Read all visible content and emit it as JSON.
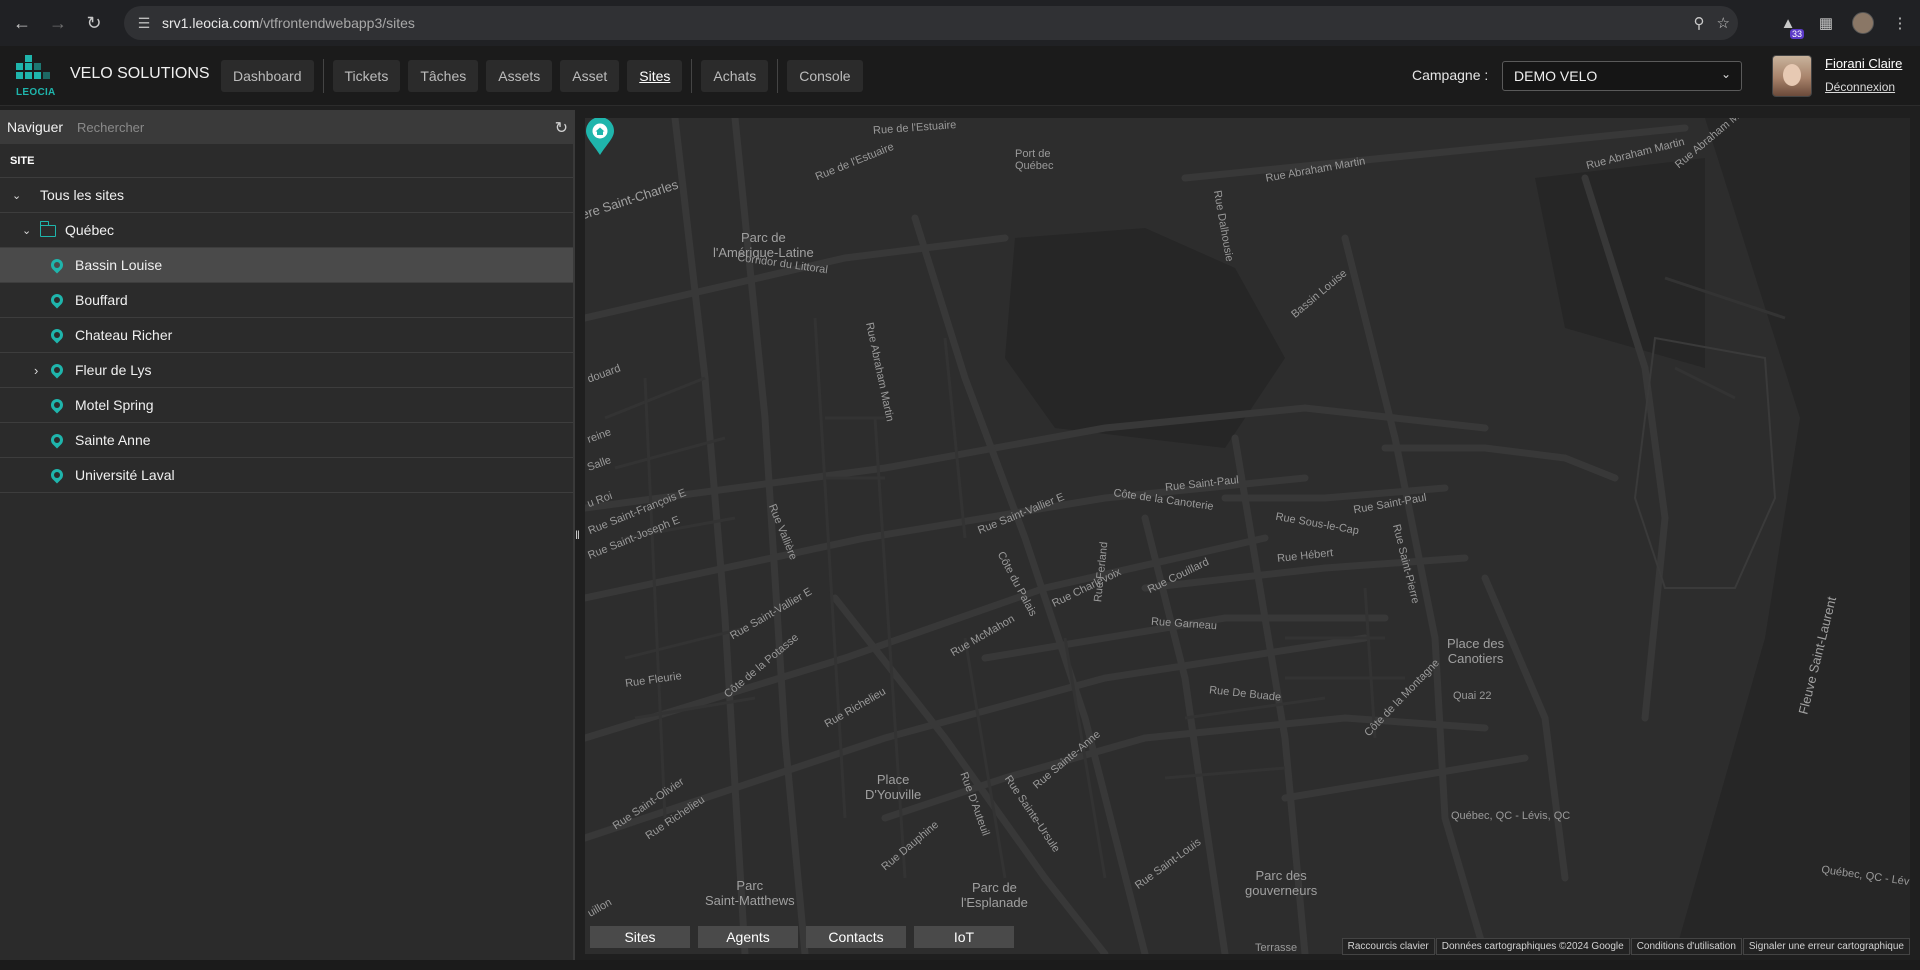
{
  "browser": {
    "url_host": "srv1.leocia.com",
    "url_path": "/vtfrontendwebapp3/sites",
    "extension_badge": "33"
  },
  "header": {
    "logo_text": "LEOCIA",
    "brand": "VELO SOLUTIONS",
    "nav": [
      {
        "label": "Dashboard"
      },
      {
        "label": "Tickets"
      },
      {
        "label": "Tâches"
      },
      {
        "label": "Assets"
      },
      {
        "label": "Asset"
      },
      {
        "label": "Sites"
      },
      {
        "label": "Achats"
      },
      {
        "label": "Console"
      }
    ],
    "active_nav": "Sites",
    "campaign_label": "Campagne :",
    "campaign_value": "DEMO VELO",
    "user_name": "Fiorani Claire",
    "logout_label": "Déconnexion"
  },
  "sidebar": {
    "search_label": "Naviguer",
    "search_placeholder": "Rechercher",
    "column_header": "SITE",
    "root": "Tous les sites",
    "group": "Québec",
    "sites": [
      {
        "label": "Bassin Louise",
        "selected": true,
        "expandable": false
      },
      {
        "label": "Bouffard",
        "selected": false,
        "expandable": false
      },
      {
        "label": "Chateau Richer",
        "selected": false,
        "expandable": false
      },
      {
        "label": "Fleur de Lys",
        "selected": false,
        "expandable": true
      },
      {
        "label": "Motel Spring",
        "selected": false,
        "expandable": false
      },
      {
        "label": "Sainte Anne",
        "selected": false,
        "expandable": false
      },
      {
        "label": "Université Laval",
        "selected": false,
        "expandable": false
      }
    ]
  },
  "map": {
    "labels": [
      {
        "text": "Rue de l'Estuaire"
      },
      {
        "text": "Rue de l'Estuaire"
      },
      {
        "text": "Port de\nQuébec"
      },
      {
        "text": "Rue Abraham Martin"
      },
      {
        "text": "Rue Abraham Martin"
      },
      {
        "text": "Rue Abraham Martin"
      },
      {
        "text": "Rue Dalhousie"
      },
      {
        "text": "ère Saint-Charles"
      },
      {
        "text": "Parc de\nl'Amérique-Latine"
      },
      {
        "text": "Corridor du Littoral"
      },
      {
        "text": "Bassin Louise"
      },
      {
        "text": "Rue Abraham Martin"
      },
      {
        "text": "Rue Saint-Paul"
      },
      {
        "text": "Côte de la Canoterie"
      },
      {
        "text": "Rue Sous-le-Cap"
      },
      {
        "text": "Rue Saint-Paul"
      },
      {
        "text": "Rue Hébert"
      },
      {
        "text": "Rue Saint-Vallier E"
      },
      {
        "text": "Rue Vallière"
      },
      {
        "text": "Côte du Palais"
      },
      {
        "text": "Rue Charlevoix"
      },
      {
        "text": "Rue Couillard"
      },
      {
        "text": "Rue Ferland"
      },
      {
        "text": "Rue Garneau"
      },
      {
        "text": "Rue Saint-Pierre"
      },
      {
        "text": "Place des\nCanotiers"
      },
      {
        "text": "Fleuve Saint-Laurent"
      },
      {
        "text": "Rue Saint-Vallier E"
      },
      {
        "text": "Rue McMahon"
      },
      {
        "text": "Côte de la Potasse"
      },
      {
        "text": "Rue Fleurie"
      },
      {
        "text": "Rue Richelieu"
      },
      {
        "text": "Rue De Buade"
      },
      {
        "text": "Côte de la Montagne"
      },
      {
        "text": "Quai 22"
      },
      {
        "text": "Rue Sainte-Anne"
      },
      {
        "text": "Place\nD'Youville"
      },
      {
        "text": "Rue D'Auteuil"
      },
      {
        "text": "Rue Sainte-Ursule"
      },
      {
        "text": "Rue Saint-Olivier"
      },
      {
        "text": "Rue Richelieu"
      },
      {
        "text": "Rue Dauphine"
      },
      {
        "text": "Québec, QC - Lévis, QC"
      },
      {
        "text": "Québec, QC - Lév"
      },
      {
        "text": "Parc\nSaint-Matthews"
      },
      {
        "text": "Parc de\nl'Esplanade"
      },
      {
        "text": "Rue Saint-Louis"
      },
      {
        "text": "Parc des\ngouverneurs"
      },
      {
        "text": "Terrasse"
      },
      {
        "text": "Rue Saint-François E"
      },
      {
        "text": "Rue Saint-Joseph E"
      },
      {
        "text": "douard"
      },
      {
        "text": "Salle"
      },
      {
        "text": "u Roi"
      },
      {
        "text": "reine"
      },
      {
        "text": "uillon"
      }
    ],
    "tabs": [
      "Sites",
      "Agents",
      "Contacts",
      "IoT"
    ],
    "attribution": [
      "Raccourcis clavier",
      "Données cartographiques ©2024 Google",
      "Conditions d'utilisation",
      "Signaler une erreur cartographique"
    ]
  }
}
